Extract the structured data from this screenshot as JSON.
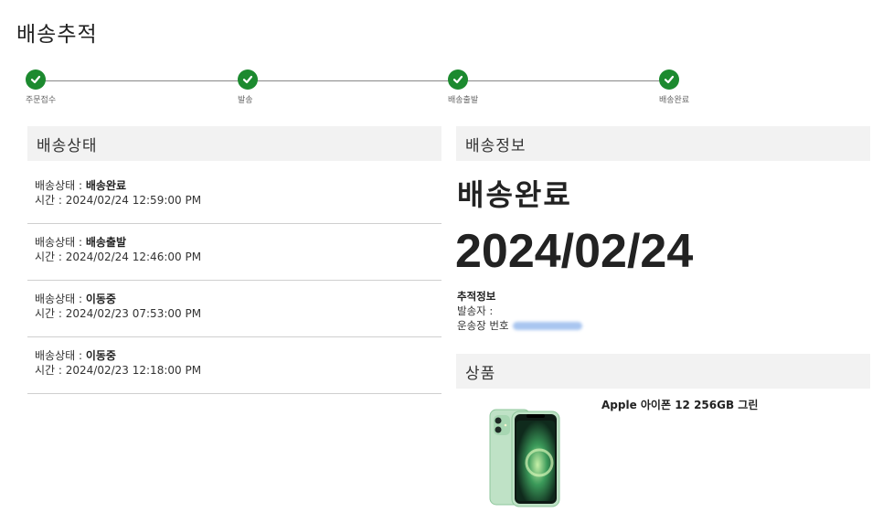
{
  "page": {
    "title": "배송추적"
  },
  "steps": [
    {
      "label": "주문접수"
    },
    {
      "label": "발송"
    },
    {
      "label": "배송출발"
    },
    {
      "label": "배송완료"
    }
  ],
  "status_section": {
    "title": "배송상태",
    "status_prefix": "배송상태 : ",
    "time_prefix": "시간 : ",
    "items": [
      {
        "status": "배송완료",
        "time": "2024/02/24 12:59:00 PM"
      },
      {
        "status": "배송출발",
        "time": "2024/02/24 12:46:00 PM"
      },
      {
        "status": "이동중",
        "time": "2024/02/23 07:53:00 PM"
      },
      {
        "status": "이동중",
        "time": "2024/02/23 12:18:00 PM"
      }
    ]
  },
  "info_section": {
    "title": "배송정보",
    "big_status": "배송완료",
    "big_date": "2024/02/24",
    "tracking_heading": "추적정보",
    "sender_label": "발송자 :",
    "waybill_label": "운송장 번호"
  },
  "product_section": {
    "title": "상품",
    "product_name": "Apple 아이폰 12 256GB 그린",
    "image_icon": "iphone-12-green"
  },
  "colors": {
    "check": "#1c8a2f",
    "header_bg": "#f2f2f2",
    "blur": "#a9c6f0"
  }
}
